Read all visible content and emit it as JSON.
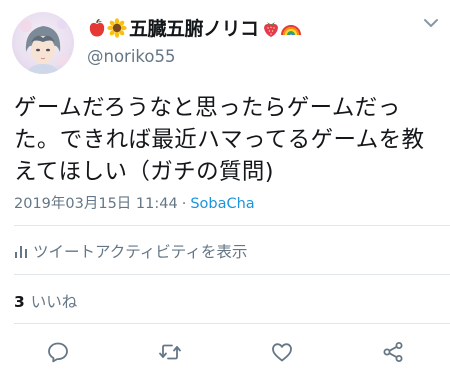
{
  "user": {
    "display_name_prefix_emoji": [
      "apple-icon",
      "sunflower-icon"
    ],
    "display_name": "五臓五腑ノリコ",
    "display_name_suffix_emoji": [
      "strawberry-icon",
      "rainbow-icon"
    ],
    "handle": "@noriko55"
  },
  "tweet": {
    "text": "ゲームだろうなと思ったらゲームだった。できれば最近ハマってるゲームを教えてほしい（ガチの質問)",
    "timestamp": "2019年03月15日 11:44",
    "separator": "·",
    "source": "SobaCha"
  },
  "activity": {
    "label": "ツイートアクティビティを表示"
  },
  "likes": {
    "count": "3",
    "label": "いいね"
  },
  "actions": [
    "reply-icon",
    "retweet-icon",
    "like-icon",
    "share-icon"
  ],
  "colors": {
    "text": "#14171a",
    "muted": "#657786",
    "link": "#1b95e0",
    "divider": "#e1e8ed"
  }
}
